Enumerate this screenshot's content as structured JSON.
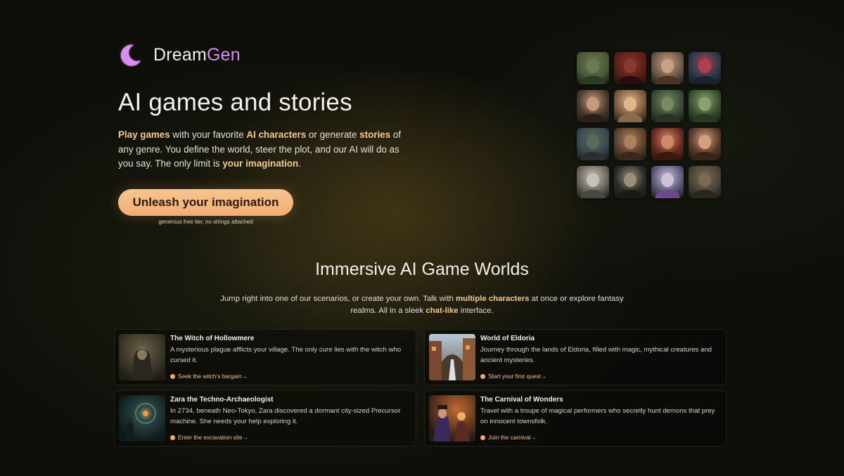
{
  "brand": {
    "name_main": "Dream",
    "name_accent": "Gen",
    "accent_color": "#d88df2"
  },
  "hero": {
    "title": "AI games and stories",
    "description": {
      "p1": "Play games",
      "p2": " with your favorite ",
      "p3": "AI characters",
      "p4": " or generate ",
      "p5": "stories",
      "p6": " of any genre. You define the world, steer the plot, and our AI will do as you say. The only limit is ",
      "p7": "your imagination",
      "p8": "."
    },
    "cta_label": "Unleash your imagination",
    "cta_subtext": "generous free tier, no strings attached",
    "cta_color": "#f5b983",
    "highlight_color": "#f6c98f"
  },
  "avatars": [
    {
      "name": "forest-tree-portrait-thumbnail",
      "bg": "#4a5a3a",
      "head": "#6b7a55",
      "body": "#2d3a24"
    },
    {
      "name": "red-demon-portrait-thumbnail",
      "bg": "#5a1e18",
      "head": "#8a3a2c",
      "body": "#2a0e0c"
    },
    {
      "name": "warrior-woman-portrait-thumbnail",
      "bg": "#6e5848",
      "head": "#c9a084",
      "body": "#4a3428"
    },
    {
      "name": "neon-city-thumbnail",
      "bg": "#2a3a4a",
      "head": "#b04050",
      "body": "#1a2230"
    },
    {
      "name": "woman-portrait-thumbnail",
      "bg": "#4a3a30",
      "head": "#c89a7c",
      "body": "#2a1e1a"
    },
    {
      "name": "blonde-woman-portrait-thumbnail",
      "bg": "#7a5a40",
      "head": "#e2b68c",
      "body": "#8a6a4a"
    },
    {
      "name": "tribal-mask-portrait-thumbnail",
      "bg": "#3a4a3a",
      "head": "#7a8a60",
      "body": "#2a3424"
    },
    {
      "name": "forest-elf-portrait-thumbnail",
      "bg": "#3a5030",
      "head": "#8aa070",
      "body": "#2a3a20"
    },
    {
      "name": "rocky-island-thumbnail",
      "bg": "#3a4850",
      "head": "#5a6a5a",
      "body": "#2a3030"
    },
    {
      "name": "bearded-man-portrait-thumbnail",
      "bg": "#5a4030",
      "head": "#b0805c",
      "body": "#3a281c"
    },
    {
      "name": "horned-woman-portrait-thumbnail",
      "bg": "#6a2a20",
      "head": "#d08a6a",
      "body": "#3a1812"
    },
    {
      "name": "brunette-woman-portrait-thumbnail",
      "bg": "#5a3a2a",
      "head": "#d4a080",
      "body": "#3a2418"
    },
    {
      "name": "old-wizard-portrait-thumbnail",
      "bg": "#6a6660",
      "head": "#c8c0b4",
      "body": "#4a4640"
    },
    {
      "name": "goblin-portrait-thumbnail",
      "bg": "#2a2a26",
      "head": "#9a9078",
      "body": "#1a1a16"
    },
    {
      "name": "elf-princess-portrait-thumbnail",
      "bg": "#5a5a7a",
      "head": "#d0c0d8",
      "body": "#6a4a8a"
    },
    {
      "name": "stone-portal-thumbnail",
      "bg": "#4a4438",
      "head": "#7a6a50",
      "body": "#2a261e"
    }
  ],
  "section": {
    "title": "Immersive AI Game Worlds",
    "desc": {
      "p1": "Jump right into one of our scenarios, or create your own. Talk with ",
      "p2": "multiple characters",
      "p3": " at once or explore fantasy realms. All in a sleek ",
      "p4": "chat-like",
      "p5": " interface."
    }
  },
  "worlds": [
    {
      "title": "The Witch of Hollowmere",
      "description": "A mysterious plague afflicts your village. The only cure lies with the witch who cursed it.",
      "link": "Seek the witch's bargain→"
    },
    {
      "title": "World of Eldoria",
      "description": "Journey through the lands of Eldoria, filled with magic, mythical creatures and ancient mysteries.",
      "link": "Start your first quest→"
    },
    {
      "title": "Zara the Techno-Archaeologist",
      "description": "In 2734, beneath Neo-Tokyo, Zara discovered a dormant city-sized Precursor machine. She needs your help exploring it.",
      "link": "Enter the excavation site→"
    },
    {
      "title": "The Carnival of Wonders",
      "description": "Travel with a troupe of magical performers who secretly hunt demons that prey on innocent townsfolk.",
      "link": "Join the carnival→"
    }
  ]
}
